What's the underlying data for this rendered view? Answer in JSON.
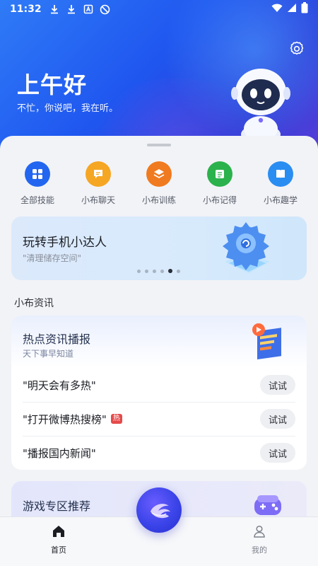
{
  "status_bar": {
    "time": "11:32"
  },
  "header": {
    "greeting": "上午好",
    "subtitle": "不忙，你说吧，我在听。"
  },
  "skills": [
    {
      "label": "全部技能",
      "icon": "grid-icon",
      "color": "#2266f0"
    },
    {
      "label": "小布聊天",
      "icon": "chat-icon",
      "color": "#f5a623"
    },
    {
      "label": "小布训练",
      "icon": "layers-icon",
      "color": "#f07a1f"
    },
    {
      "label": "小布记得",
      "icon": "list-icon",
      "color": "#2bb24c"
    },
    {
      "label": "小布趣学",
      "icon": "book-icon",
      "color": "#2a8df2"
    }
  ],
  "banner": {
    "title": "玩转手机小达人",
    "subtitle": "\"清理储存空间\"",
    "page_count": 6,
    "active_index": 4
  },
  "news_section": {
    "title": "小布资讯",
    "card_title": "热点资讯播报",
    "card_subtitle": "天下事早知道",
    "items": [
      {
        "text": "\"明天会有多热\"",
        "badge": "",
        "button": "试试"
      },
      {
        "text": "\"打开微博热搜榜\"",
        "badge": "热",
        "button": "试试"
      },
      {
        "text": "\"播报国内新闻\"",
        "badge": "",
        "button": "试试"
      }
    ]
  },
  "game_section": {
    "title": "游戏专区推荐"
  },
  "bottom_nav": {
    "home_label": "首页",
    "mine_label": "我的"
  }
}
